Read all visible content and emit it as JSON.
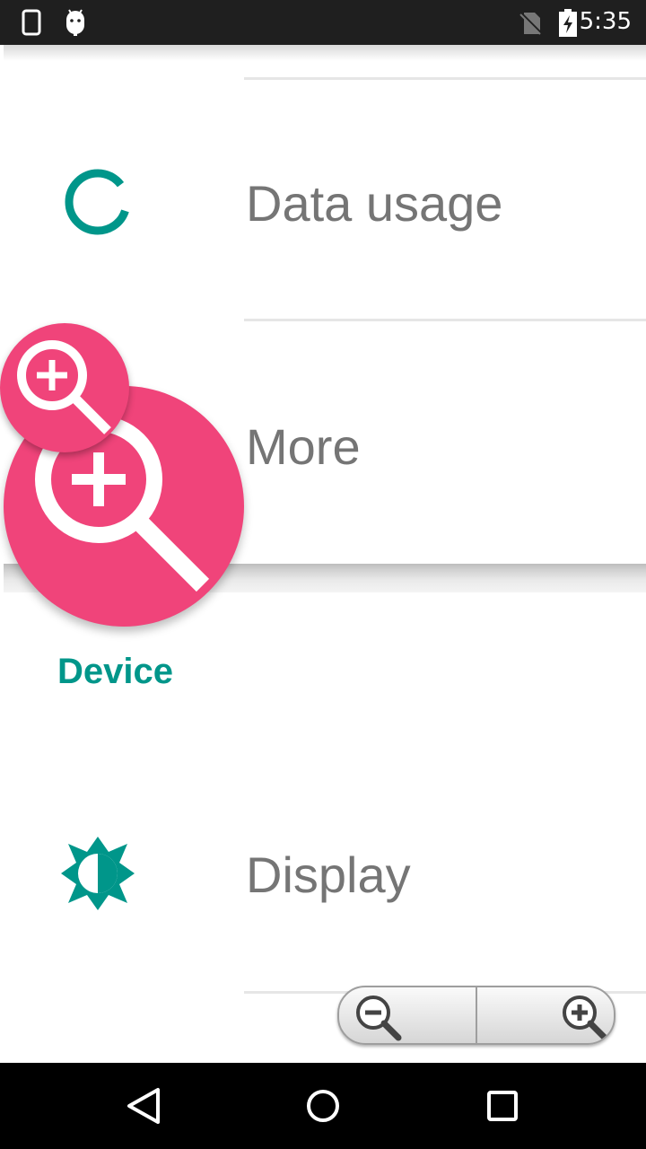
{
  "status_bar": {
    "time": "5:35",
    "icons": [
      "phone-icon",
      "android-icon",
      "no-sim-icon",
      "battery-charging-icon"
    ]
  },
  "settings": {
    "items": [
      {
        "label": "Data usage",
        "icon": "data-usage-icon"
      },
      {
        "label": "More",
        "icon": "more-icon"
      }
    ],
    "section_header": "Device",
    "device_items": [
      {
        "label": "Display",
        "icon": "brightness-icon"
      }
    ]
  },
  "overlay": {
    "magnifier_icons": [
      "zoom-in-magnifier-large",
      "zoom-in-magnifier-small"
    ],
    "accent_color": "#f0447a"
  },
  "zoom_control": {
    "zoom_out": "zoom-out-icon",
    "zoom_in": "zoom-in-icon"
  },
  "nav_bar": {
    "buttons": [
      "back-icon",
      "home-icon",
      "recents-icon"
    ]
  },
  "colors": {
    "accent": "#00968a",
    "text": "#757575",
    "status_bar": "#1f1f1f"
  }
}
